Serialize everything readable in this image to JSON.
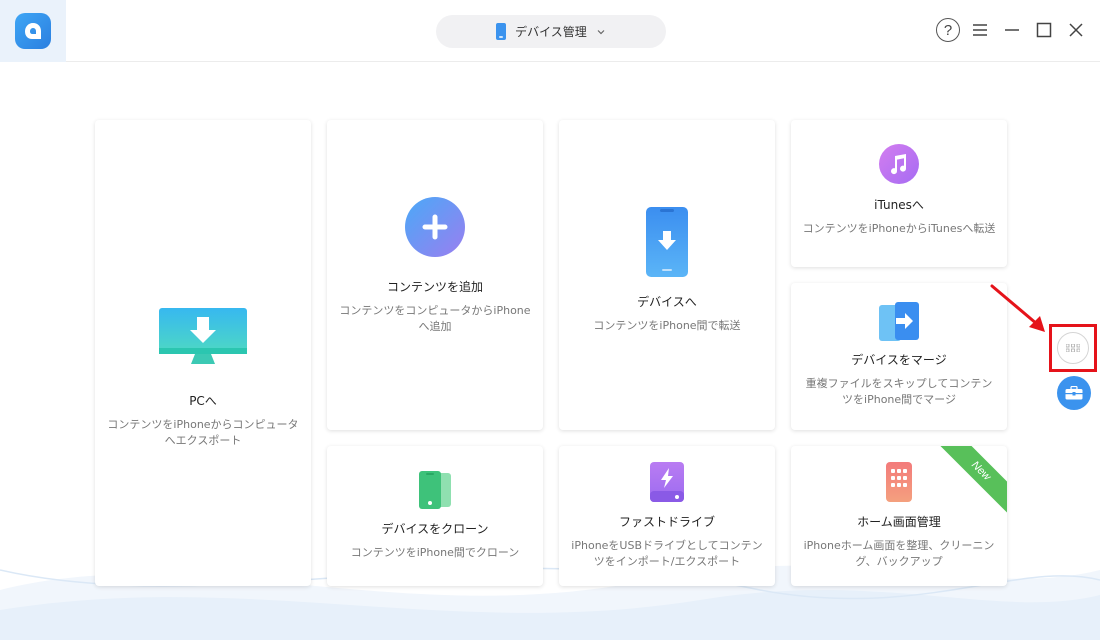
{
  "header": {
    "device_label": "デバイス管理",
    "help_label": "?"
  },
  "cards": {
    "to_pc": {
      "title": "PCへ",
      "desc": "コンテンツをiPhoneからコンピュータへエクスポート"
    },
    "add_content": {
      "title": "コンテンツを追加",
      "desc": "コンテンツをコンピュータからiPhoneへ追加"
    },
    "to_device": {
      "title": "デバイスへ",
      "desc": "コンテンツをiPhone間で転送"
    },
    "to_itunes": {
      "title": "iTunesへ",
      "desc": "コンテンツをiPhoneからiTunesへ転送"
    },
    "merge_device": {
      "title": "デバイスをマージ",
      "desc": "重複ファイルをスキップしてコンテンツをiPhone間でマージ"
    },
    "clone_device": {
      "title": "デバイスをクローン",
      "desc": "コンテンツをiPhone間でクローン"
    },
    "fast_drive": {
      "title": "ファストドライブ",
      "desc": "iPhoneをUSBドライブとしてコンテンツをインポート/エクスポート"
    },
    "home_screen": {
      "title": "ホーム画面管理",
      "desc": "iPhoneホーム画面を整理、クリーニング、バックアップ",
      "badge": "New"
    }
  },
  "colors": {
    "accent": "#3b93ee",
    "highlight": "#e5131a",
    "new_badge": "#58c05a"
  }
}
